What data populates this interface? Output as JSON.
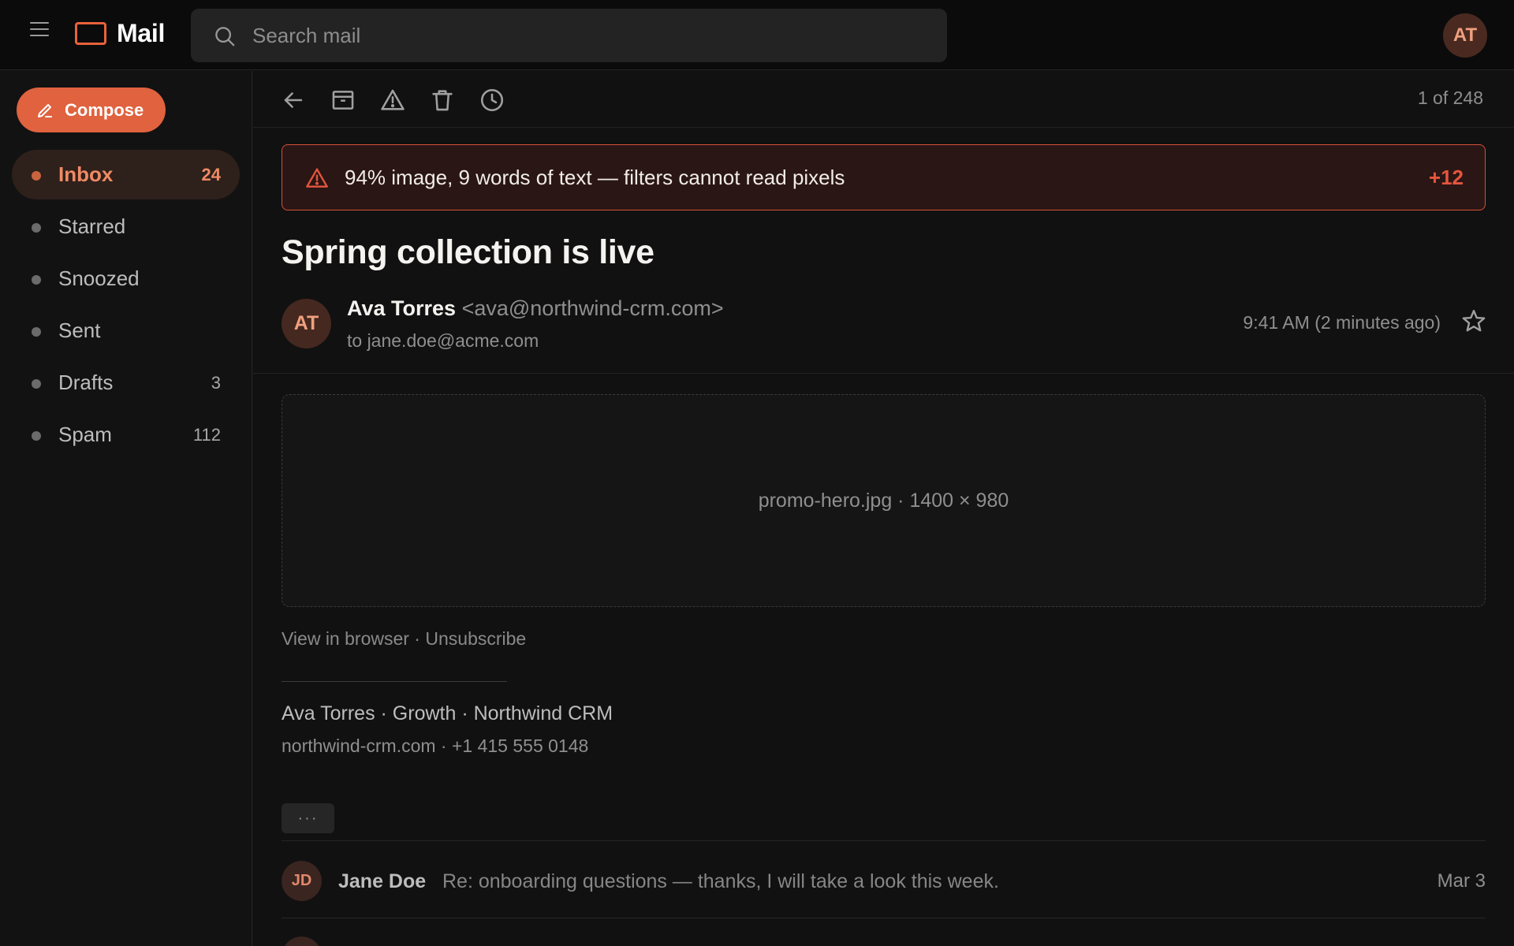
{
  "app": {
    "title": "Mail"
  },
  "header": {
    "search": {
      "placeholder": "Search mail",
      "value": ""
    },
    "avatar_initials": "AT"
  },
  "sidebar": {
    "compose_label": "Compose",
    "items": [
      {
        "label": "Inbox",
        "count": "24",
        "active": true
      },
      {
        "label": "Starred",
        "count": ""
      },
      {
        "label": "Snoozed",
        "count": ""
      },
      {
        "label": "Sent",
        "count": ""
      },
      {
        "label": "Drafts",
        "count": "3"
      },
      {
        "label": "Spam",
        "count": "112"
      }
    ]
  },
  "toolbar": {
    "icons": [
      "back-arrow-icon",
      "archive-icon",
      "report-spam-icon",
      "trash-icon",
      "snooze-clock-icon"
    ],
    "pager": "1 of 248"
  },
  "warning": {
    "text": "94% image, 9 words of text — filters cannot read pixels",
    "score": "+12"
  },
  "message": {
    "subject": "Spring collection is live",
    "sender_initials": "AT",
    "sender_name": "Ava Torres",
    "sender_email": "<ava@northwind-crm.com>",
    "recipient": "to jane.doe@acme.com",
    "time": "9:41 AM (2 minutes ago)",
    "image_label": "promo-hero.jpg · 1400 × 980",
    "view_in_browser": "View in browser",
    "separator": " · ",
    "unsubscribe": "Unsubscribe",
    "signature_name": "Ava Torres · Growth · Northwind CRM",
    "signature_contact": "northwind-crm.com · +1 415 555 0148",
    "more_label": "···"
  },
  "thread": [
    {
      "initials": "JD",
      "name": "Jane Doe",
      "snippet": "Re: onboarding questions — thanks, I will take a look this week.",
      "date": "Mar 3"
    }
  ],
  "colors": {
    "accent": "#e0623f",
    "warning_border": "#d5503a",
    "warning_bg": "#2a1614",
    "background": "#121212"
  }
}
